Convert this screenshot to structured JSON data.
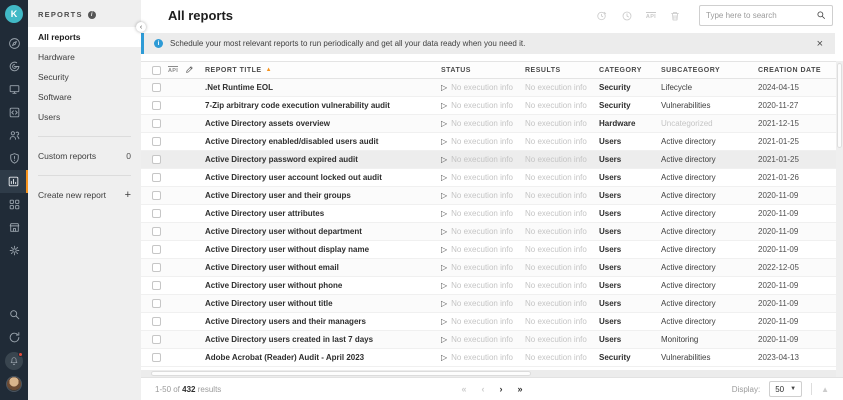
{
  "colors": {
    "rail_bg": "#202b37",
    "accent_orange": "#f7941d",
    "logo_teal": "#41b9c6",
    "banner_blue": "#2e9bd6",
    "sidebar_bg": "#efefef"
  },
  "rail": {
    "logo_initial": "K",
    "icons": [
      "compass-icon",
      "radar-icon",
      "monitor-icon",
      "code-box-icon",
      "users-icon",
      "shield-icon",
      "reports-chart-icon",
      "apps-grid-icon",
      "store-icon",
      "gear-icon"
    ],
    "active_icon": "reports-chart-icon",
    "bottom_icons": [
      "search-icon",
      "refresh-icon",
      "bell-icon",
      "user-avatar"
    ],
    "bell_has_badge": true
  },
  "sidebar": {
    "header": "REPORTS",
    "items": [
      {
        "label": "All reports",
        "active": true
      },
      {
        "label": "Hardware",
        "active": false
      },
      {
        "label": "Security",
        "active": false
      },
      {
        "label": "Software",
        "active": false
      },
      {
        "label": "Users",
        "active": false
      }
    ],
    "custom_reports": {
      "label": "Custom reports",
      "count": "0"
    },
    "create_new": {
      "label": "Create new report",
      "plus": "+"
    }
  },
  "header": {
    "title": "All reports",
    "tool_icons": [
      "schedule-report-icon",
      "clock-icon",
      "api-icon",
      "trash-icon"
    ],
    "search_placeholder": "Type here to search"
  },
  "banner": {
    "text": "Schedule your most relevant reports to run periodically and get all your data ready when you need it.",
    "close": "×"
  },
  "table": {
    "columns": [
      "REPORT TITLE",
      "STATUS",
      "RESULTS",
      "CATEGORY",
      "SUBCATEGORY",
      "CREATION DATE"
    ],
    "sort_column": "REPORT TITLE",
    "sort_direction": "ascending",
    "rows": [
      {
        "title": ".Net Runtime EOL",
        "status": "No execution info",
        "results": "No execution info",
        "category": "Security",
        "subcategory": "Lifecycle",
        "date": "2024-04-15"
      },
      {
        "title": "7-Zip arbitrary code execution vulnerability audit",
        "status": "No execution info",
        "results": "No execution info",
        "category": "Security",
        "subcategory": "Vulnerabilities",
        "date": "2020-11-27"
      },
      {
        "title": "Active Directory assets overview",
        "status": "No execution info",
        "results": "No execution info",
        "category": "Hardware",
        "subcategory": "Uncategorized",
        "subcategory_muted": true,
        "date": "2021-12-15"
      },
      {
        "title": "Active Directory enabled/disabled users audit",
        "status": "No execution info",
        "results": "No execution info",
        "category": "Users",
        "subcategory": "Active directory",
        "date": "2021-01-25"
      },
      {
        "title": "Active Directory password expired audit",
        "status": "No execution info",
        "results": "No execution info",
        "category": "Users",
        "subcategory": "Active directory",
        "date": "2021-01-25",
        "highlight": true
      },
      {
        "title": "Active Directory user account locked out audit",
        "status": "No execution info",
        "results": "No execution info",
        "category": "Users",
        "subcategory": "Active directory",
        "date": "2021-01-26"
      },
      {
        "title": "Active Directory user and their groups",
        "status": "No execution info",
        "results": "No execution info",
        "category": "Users",
        "subcategory": "Active directory",
        "date": "2020-11-09"
      },
      {
        "title": "Active Directory user attributes",
        "status": "No execution info",
        "results": "No execution info",
        "category": "Users",
        "subcategory": "Active directory",
        "date": "2020-11-09"
      },
      {
        "title": "Active Directory user without department",
        "status": "No execution info",
        "results": "No execution info",
        "category": "Users",
        "subcategory": "Active directory",
        "date": "2020-11-09"
      },
      {
        "title": "Active Directory user without display name",
        "status": "No execution info",
        "results": "No execution info",
        "category": "Users",
        "subcategory": "Active directory",
        "date": "2020-11-09"
      },
      {
        "title": "Active Directory user without email",
        "status": "No execution info",
        "results": "No execution info",
        "category": "Users",
        "subcategory": "Active directory",
        "date": "2022-12-05"
      },
      {
        "title": "Active Directory user without phone",
        "status": "No execution info",
        "results": "No execution info",
        "category": "Users",
        "subcategory": "Active directory",
        "date": "2020-11-09"
      },
      {
        "title": "Active Directory user without title",
        "status": "No execution info",
        "results": "No execution info",
        "category": "Users",
        "subcategory": "Active directory",
        "date": "2020-11-09"
      },
      {
        "title": "Active Directory users and their managers",
        "status": "No execution info",
        "results": "No execution info",
        "category": "Users",
        "subcategory": "Active directory",
        "date": "2020-11-09"
      },
      {
        "title": "Active Directory users created in last 7 days",
        "status": "No execution info",
        "results": "No execution info",
        "category": "Users",
        "subcategory": "Monitoring",
        "date": "2020-11-09"
      },
      {
        "title": "Adobe Acrobat (Reader) Audit - April 2023",
        "status": "No execution info",
        "results": "No execution info",
        "category": "Security",
        "subcategory": "Vulnerabilities",
        "date": "2023-04-13"
      }
    ]
  },
  "footer": {
    "results_prefix": "1-50 of",
    "results_count": "432",
    "results_suffix": "results",
    "pagination": [
      "first",
      "previous",
      "next",
      "last"
    ],
    "display_label": "Display:",
    "display_value": "50"
  }
}
